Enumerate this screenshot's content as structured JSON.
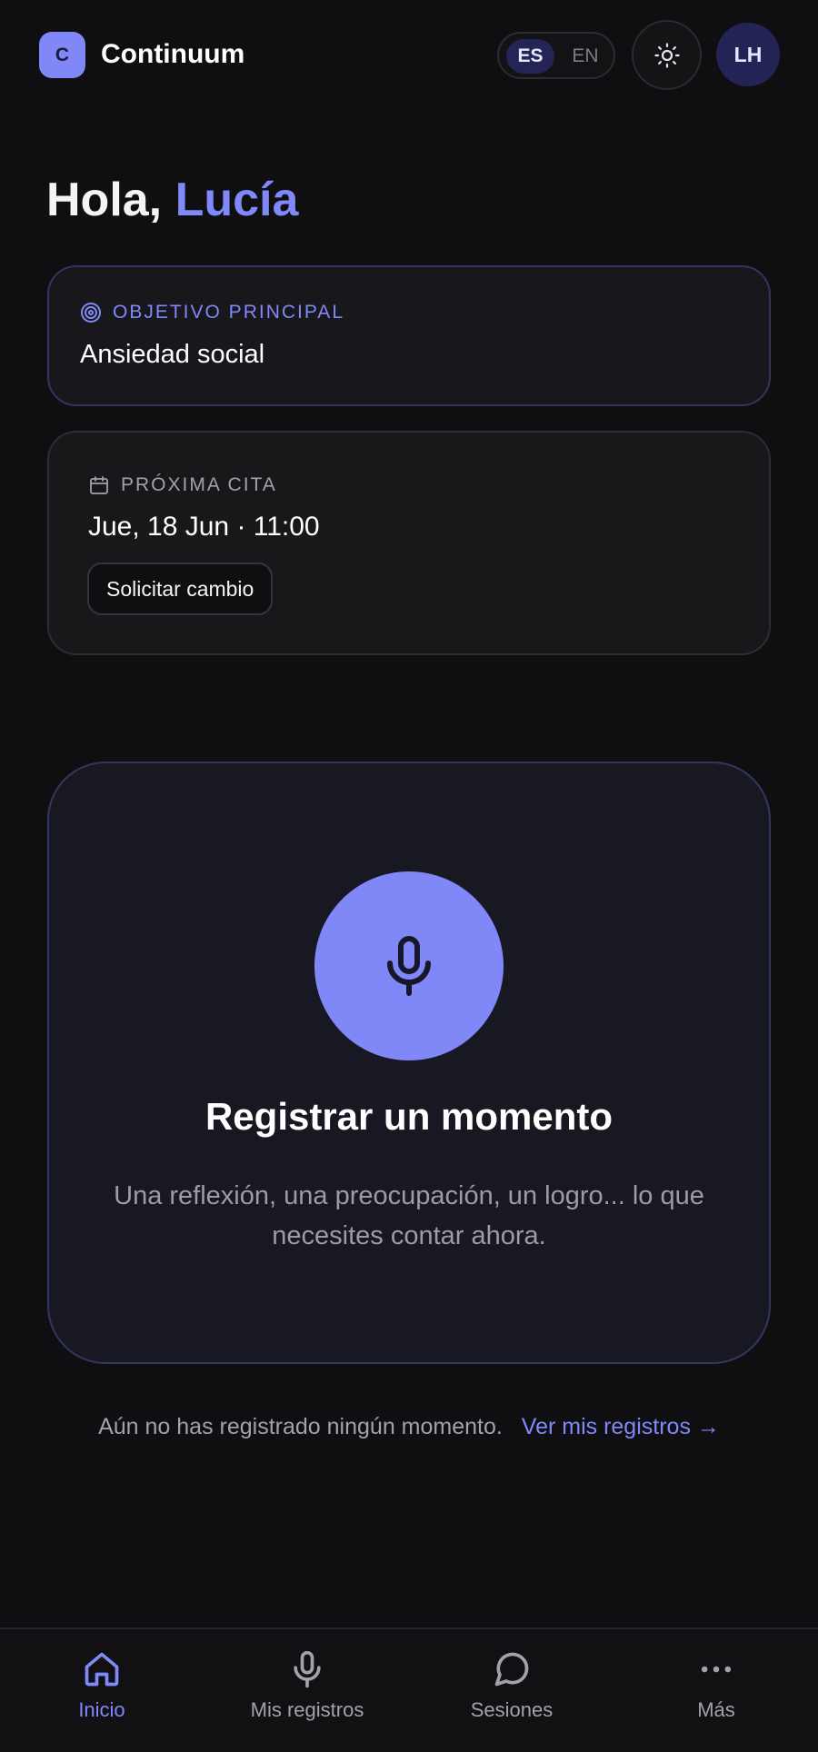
{
  "header": {
    "logo_letter": "C",
    "app_name": "Continuum",
    "lang_active": "ES",
    "lang_inactive": "EN",
    "avatar_initials": "LH"
  },
  "greeting": {
    "prefix": "Hola,",
    "name": "Lucía"
  },
  "goal_card": {
    "label": "OBJETIVO PRINCIPAL",
    "value": "Ansiedad social"
  },
  "appointment_card": {
    "label": "PRÓXIMA CITA",
    "value": "Jue, 18 Jun · 11:00",
    "button_label": "Solicitar cambio"
  },
  "record_card": {
    "title": "Registrar un momento",
    "description": "Una reflexión, una preocupación, un logro... lo que necesites contar ahora."
  },
  "records_note": {
    "text": "Aún no has registrado ningún momento.",
    "link_label": "Ver mis registros",
    "link_arrow": "→"
  },
  "bottom_nav": {
    "items": [
      {
        "label": "Inicio",
        "icon": "home-icon",
        "active": true
      },
      {
        "label": "Mis registros",
        "icon": "microphone-icon",
        "active": false
      },
      {
        "label": "Sesiones",
        "icon": "chat-bubble-icon",
        "active": false
      },
      {
        "label": "Más",
        "icon": "more-dots-icon",
        "active": false
      }
    ]
  },
  "colors": {
    "background": "#0f0f11",
    "accent": "#8088f8",
    "muted_text": "#a2a2aa"
  }
}
